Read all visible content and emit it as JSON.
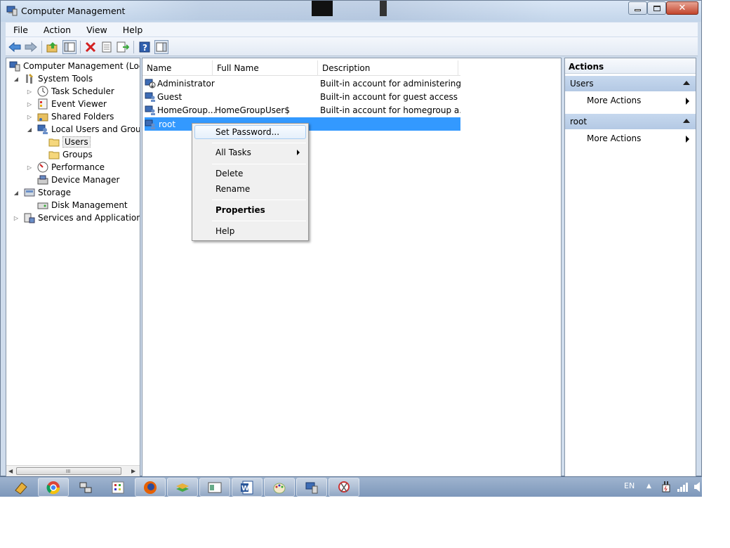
{
  "window": {
    "title": "Computer Management",
    "app_icon": "computer-management-icon"
  },
  "menubar": [
    "File",
    "Action",
    "View",
    "Help"
  ],
  "toolbar": {
    "buttons": [
      "back-icon",
      "forward-icon",
      "up-level-icon",
      "show-hide-console-tree-icon",
      "delete-icon",
      "properties-icon",
      "export-list-icon",
      "help-icon",
      "show-hide-action-pane-icon"
    ]
  },
  "tree": {
    "items": [
      {
        "label": "Computer Management (Local",
        "expander": "",
        "icon": "computer-management-icon"
      },
      {
        "label": "System Tools",
        "expander": "◢",
        "icon": "system-tools-icon"
      },
      {
        "label": "Task Scheduler",
        "expander": "▷",
        "icon": "task-scheduler-icon"
      },
      {
        "label": "Event Viewer",
        "expander": "▷",
        "icon": "event-viewer-icon"
      },
      {
        "label": "Shared Folders",
        "expander": "▷",
        "icon": "shared-folders-icon"
      },
      {
        "label": "Local Users and Groups",
        "expander": "◢",
        "icon": "users-groups-icon"
      },
      {
        "label": "Users",
        "expander": "",
        "icon": "folder-icon"
      },
      {
        "label": "Groups",
        "expander": "",
        "icon": "folder-icon"
      },
      {
        "label": "Performance",
        "expander": "▷",
        "icon": "performance-icon"
      },
      {
        "label": "Device Manager",
        "expander": "",
        "icon": "device-manager-icon"
      },
      {
        "label": "Storage",
        "expander": "◢",
        "icon": "storage-icon"
      },
      {
        "label": "Disk Management",
        "expander": "",
        "icon": "disk-management-icon"
      },
      {
        "label": "Services and Applications",
        "expander": "▷",
        "icon": "services-applications-icon"
      }
    ],
    "scroll_grip": "III"
  },
  "list": {
    "columns": [
      "Name",
      "Full Name",
      "Description"
    ],
    "rows": [
      {
        "name": "Administrator",
        "full_name": "",
        "description": "Built-in account for administering..."
      },
      {
        "name": "Guest",
        "full_name": "",
        "description": "Built-in account for guest access t..."
      },
      {
        "name": "HomeGroup...",
        "full_name": "HomeGroupUser$",
        "description": "Built-in account for homegroup a..."
      },
      {
        "name": "root",
        "full_name": "",
        "description": ""
      }
    ]
  },
  "actions": {
    "title": "Actions",
    "sections": [
      {
        "label": "Users",
        "item": "More Actions"
      },
      {
        "label": "root",
        "item": "More Actions"
      }
    ]
  },
  "context_menu": {
    "items": [
      "Set Password...",
      "All Tasks",
      "Delete",
      "Rename",
      "Properties",
      "Help"
    ]
  },
  "taskbar": {
    "apps": [
      "start-icon",
      "chrome-icon",
      "network-icon",
      "app-grid-icon",
      "firefox-icon",
      "stack-app-icon",
      "window-app-icon",
      "word-icon",
      "paint-icon",
      "computer-management-icon",
      "snipping-tool-icon"
    ],
    "language": "EN"
  },
  "colors": {
    "selection": "#3399ff",
    "frame": "#cfdcec",
    "taskbar": "#8ba3c3"
  }
}
